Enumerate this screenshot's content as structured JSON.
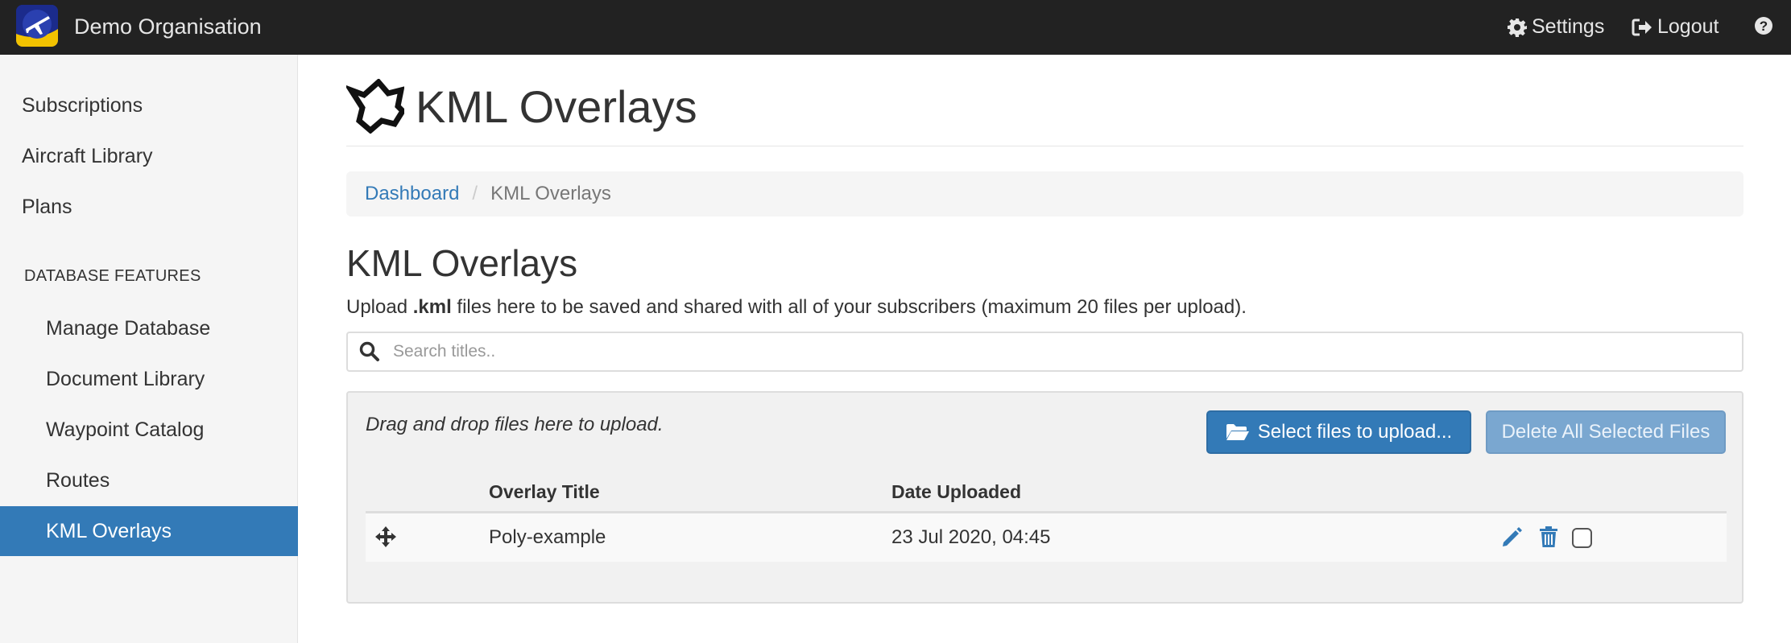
{
  "navbar": {
    "org_name": "Demo Organisation",
    "settings_label": "Settings",
    "logout_label": "Logout",
    "help_icon": "question-circle-icon"
  },
  "sidebar": {
    "items_top": [
      {
        "label": "Subscriptions"
      },
      {
        "label": "Aircraft Library"
      },
      {
        "label": "Plans"
      }
    ],
    "section_header": "DATABASE FEATURES",
    "items_sub": [
      {
        "label": "Manage Database"
      },
      {
        "label": "Document Library"
      },
      {
        "label": "Waypoint Catalog"
      },
      {
        "label": "Routes"
      },
      {
        "label": "KML Overlays",
        "active": true
      }
    ]
  },
  "page": {
    "title": "KML Overlays",
    "breadcrumb": {
      "link": "Dashboard",
      "current": "KML Overlays"
    },
    "section_title": "KML Overlays",
    "intro_prefix": "Upload ",
    "intro_bold": ".kml",
    "intro_suffix": " files here to be saved and shared with all of your subscribers (maximum 20 files per upload).",
    "search_placeholder": "Search titles..",
    "drop_text": "Drag and drop files here to upload.",
    "select_button": "Select files to upload...",
    "delete_button": "Delete All Selected Files"
  },
  "table": {
    "columns": [
      "Overlay Title",
      "Date Uploaded"
    ],
    "rows": [
      {
        "title": "Poly-example",
        "date": "23 Jul 2020, 04:45",
        "selected": false
      }
    ]
  },
  "colors": {
    "navbar_bg": "#222222",
    "accent": "#337ab7",
    "sidebar_bg": "#f5f5f5"
  }
}
